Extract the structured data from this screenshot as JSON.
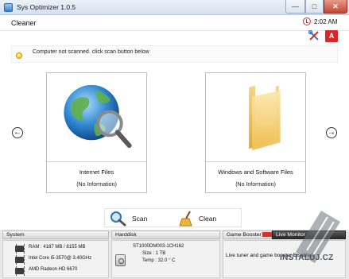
{
  "window": {
    "title": "Sys Optimizer 1.0.5"
  },
  "header": {
    "section_title": "Cleaner",
    "time": "2:02 AM",
    "alert_badge": "A"
  },
  "status": {
    "message": "Computer not scanned. click scan button below"
  },
  "cards": [
    {
      "name": "Internet Files",
      "info": "(No Information)"
    },
    {
      "name": "Windows and Software Files",
      "info": "(No Information)"
    }
  ],
  "actions": {
    "scan_label": "Scan",
    "clean_label": "Clean"
  },
  "bottom": {
    "system": {
      "title": "System",
      "ram": "RAM : 4187 MB / 8155 MB",
      "cpu": "Intel Core i5-3570@ 3.40GHz",
      "gpu": "AMD Radeon HD 6670"
    },
    "harddisk": {
      "title": "Harddisk",
      "model": "ST1000DM003-1CH162",
      "size": "Size : 1 TB",
      "temp": "Temp : 32.0 ° C"
    },
    "game_booster": {
      "title": "Game Booster",
      "description": "Live tuner and game booster Disabled"
    },
    "live_monitor": {
      "title": "Live Monitor"
    }
  },
  "watermark": {
    "text": "INSTALUJ.CZ"
  },
  "colors": {
    "accent_red": "#d7262a",
    "clock_red": "#cc2a2a",
    "bulb_yellow": "#f0c000"
  }
}
